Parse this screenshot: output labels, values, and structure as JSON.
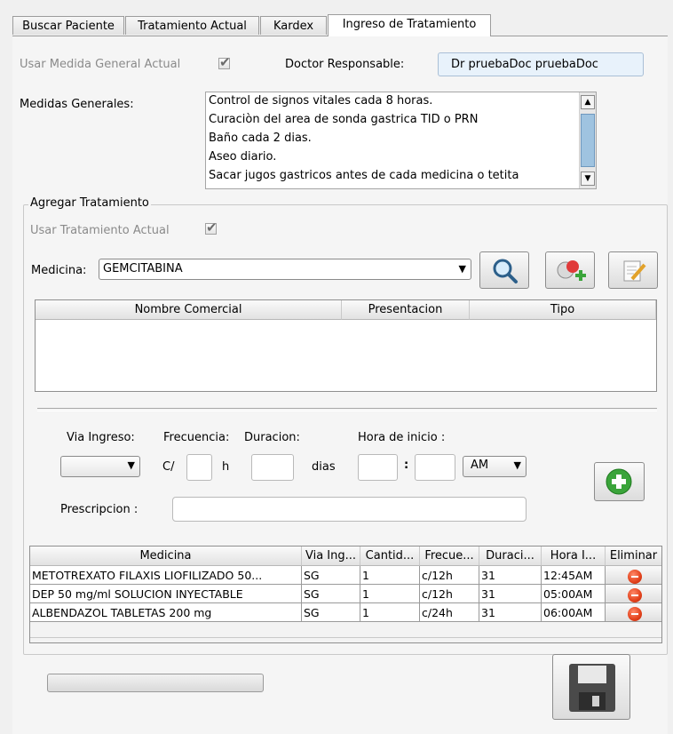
{
  "tabs": [
    {
      "label": "Buscar Paciente"
    },
    {
      "label": "Tratamiento Actual"
    },
    {
      "label": "Kardex"
    },
    {
      "label": "Ingreso de Tratamiento"
    }
  ],
  "header": {
    "usar_medida_label": "Usar Medida General Actual",
    "usar_medida_checked": true,
    "doctor_label": "Doctor Responsable:",
    "doctor_value": "Dr pruebaDoc pruebaDoc"
  },
  "medidas": {
    "label": "Medidas Generales:",
    "lines": [
      "Control de signos vitales cada 8 horas.",
      "Curaciòn del area de sonda gastrica TID o PRN",
      "Baño cada 2 dias.",
      "Aseo diario.",
      "Sacar jugos gastricos antes de cada medicina o tetita"
    ]
  },
  "agregar": {
    "group_title": "Agregar Tratamiento",
    "usar_tratamiento_label": "Usar Tratamiento Actual",
    "usar_tratamiento_checked": true,
    "medicina_label": "Medicina:",
    "medicina_value": "GEMCITABINA",
    "columns": [
      "Nombre Comercial",
      "Presentacion",
      "Tipo"
    ]
  },
  "form": {
    "via_label": "Via Ingreso:",
    "frecuencia_label": "Frecuencia:",
    "duracion_label": "Duracion:",
    "hora_label": "Hora de inicio :",
    "c_label": "C/",
    "h_label": "h",
    "dias_label": "dias",
    "colon": ":",
    "ampm_value": "AM",
    "prescripcion_label": "Prescripcion :"
  },
  "treatments": {
    "columns": [
      "Medicina",
      "Via Ing...",
      "Cantid...",
      "Frecue...",
      "Duraci...",
      "Hora I...",
      "Eliminar"
    ],
    "rows": [
      {
        "medicina": "METOTREXATO FILAXIS LIOFILIZADO 50...",
        "via": "SG",
        "cantidad": "1",
        "frecuencia": "c/12h",
        "duracion": "31",
        "hora": "12:45AM"
      },
      {
        "medicina": "DEP 50 mg/ml SOLUCION INYECTABLE",
        "via": "SG",
        "cantidad": "1",
        "frecuencia": "c/12h",
        "duracion": "31",
        "hora": "05:00AM"
      },
      {
        "medicina": "ALBENDAZOL TABLETAS 200 mg",
        "via": "SG",
        "cantidad": "1",
        "frecuencia": "c/24h",
        "duracion": "31",
        "hora": "06:00AM"
      }
    ]
  },
  "icons": {
    "search": "search-icon",
    "add_medicine": "add-medicine-icon",
    "edit": "edit-icon",
    "add": "plus-circle-icon",
    "delete": "minus-circle-icon",
    "save": "floppy-disk-icon"
  },
  "colors": {
    "add_green": "#3aa43a",
    "delete_red": "#e2401a",
    "doctor_field_bg": "#e8f2fb",
    "scroll_thumb": "#9fc3e0"
  }
}
